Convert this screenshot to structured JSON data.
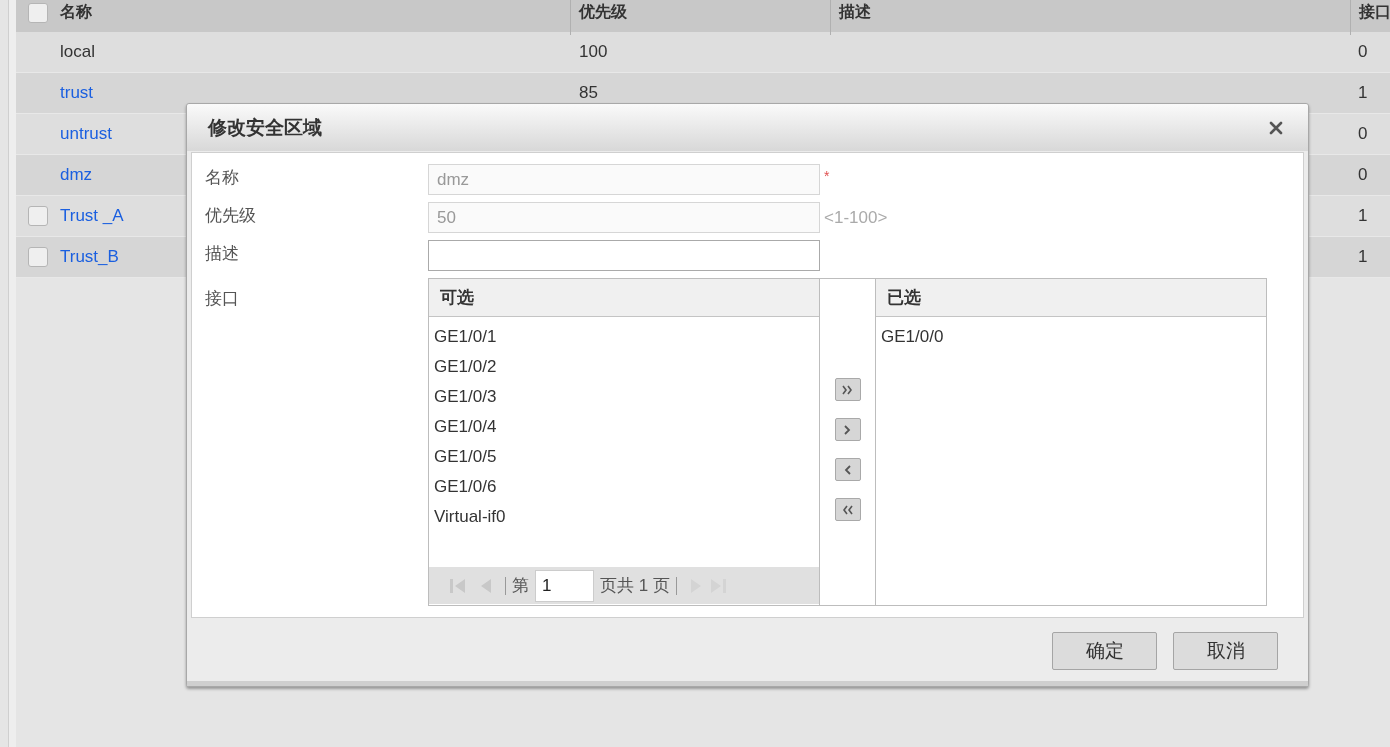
{
  "table": {
    "header_checkbox": {
      "checked": false
    },
    "columns": [
      "名称",
      "优先级",
      "描述",
      "接口"
    ],
    "rows": [
      {
        "name": "local",
        "link": false,
        "priority": "100",
        "interfaces": "0"
      },
      {
        "name": "trust",
        "link": true,
        "priority": "85",
        "interfaces": "1"
      },
      {
        "name": "untrust",
        "link": true,
        "interfaces": "0"
      },
      {
        "name": "dmz",
        "link": true,
        "interfaces": "0"
      },
      {
        "name": "Trust _A",
        "link": true,
        "checked": false,
        "interfaces": "1"
      },
      {
        "name": "Trust_B",
        "link": true,
        "checked": false,
        "interfaces": "1"
      }
    ]
  },
  "dialog": {
    "title": "修改安全区域",
    "fields": [
      {
        "label": "名称",
        "value": "dmz",
        "disabled": true,
        "note": "*",
        "required": true
      },
      {
        "label": "优先级",
        "value": "50",
        "disabled": true,
        "note": "<1-100>",
        "required": false
      },
      {
        "label": "描述",
        "disabled": false
      }
    ],
    "interface_label": "接口",
    "available": {
      "title": "可选",
      "items": [
        "GE1/0/1",
        "GE1/0/2",
        "GE1/0/3",
        "GE1/0/4",
        "GE1/0/5",
        "GE1/0/6",
        "Virtual-if0"
      ]
    },
    "pager": {
      "prefix": "第",
      "page": "1",
      "suffix": "页共 1 页"
    },
    "selected": {
      "title": "已选",
      "items": [
        "GE1/0/0"
      ]
    },
    "buttons": [
      "确定",
      "取消"
    ]
  }
}
